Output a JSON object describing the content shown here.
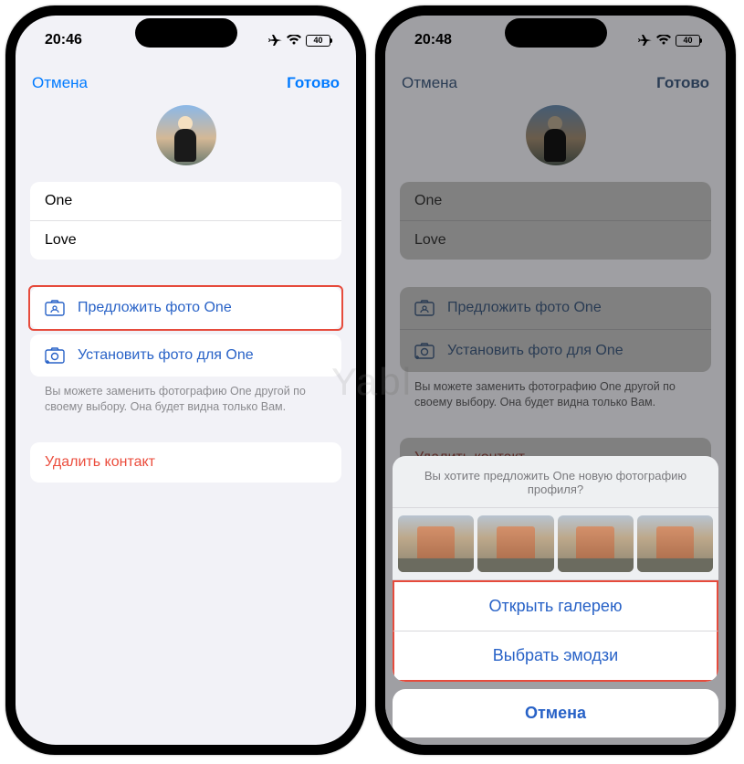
{
  "watermark": "Yabl",
  "left": {
    "status": {
      "time": "20:46",
      "battery": "40"
    },
    "nav": {
      "cancel": "Отмена",
      "done": "Готово"
    },
    "fields": {
      "first_name": "One",
      "last_name": "Love"
    },
    "actions": {
      "suggest": "Предложить фото One",
      "set": "Установить фото для One",
      "hint": "Вы можете заменить фотографию One другой по своему выбору. Она будет видна только Вам."
    },
    "delete": "Удалить контакт"
  },
  "right": {
    "status": {
      "time": "20:48",
      "battery": "40"
    },
    "nav": {
      "cancel": "Отмена",
      "done": "Готово"
    },
    "fields": {
      "first_name": "One",
      "last_name": "Love"
    },
    "actions": {
      "suggest": "Предложить фото One",
      "set": "Установить фото для One",
      "hint": "Вы можете заменить фотографию One другой по своему выбору. Она будет видна только Вам."
    },
    "delete": "Удалить контакт",
    "sheet": {
      "title": "Вы хотите предложить One новую фотографию профиля?",
      "open_gallery": "Открыть галерею",
      "choose_emoji": "Выбрать эмодзи",
      "cancel": "Отмена"
    }
  }
}
